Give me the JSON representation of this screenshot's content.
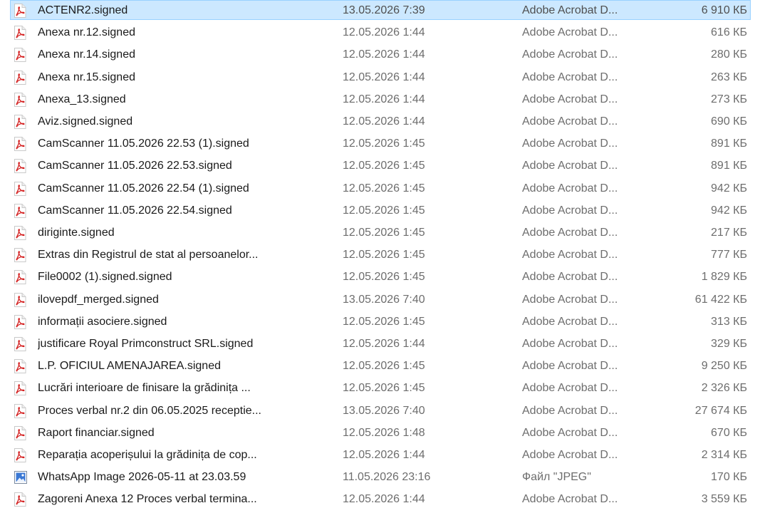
{
  "colors": {
    "selection_bg": "#cce8ff",
    "selection_border": "#99d1ff",
    "pdf_red": "#d42020",
    "secondary_text": "#6d6d6d"
  },
  "files": [
    {
      "name": "ACTENR2.signed",
      "date": "13.05.2026 7:39",
      "type": "Adobe Acrobat D...",
      "size": "6 910 КБ",
      "icon": "pdf-icon",
      "selected": true
    },
    {
      "name": "Anexa nr.12.signed",
      "date": "12.05.2026 1:44",
      "type": "Adobe Acrobat D...",
      "size": "616 КБ",
      "icon": "pdf-icon",
      "selected": false
    },
    {
      "name": "Anexa nr.14.signed",
      "date": "12.05.2026 1:44",
      "type": "Adobe Acrobat D...",
      "size": "280 КБ",
      "icon": "pdf-icon",
      "selected": false
    },
    {
      "name": "Anexa nr.15.signed",
      "date": "12.05.2026 1:44",
      "type": "Adobe Acrobat D...",
      "size": "263 КБ",
      "icon": "pdf-icon",
      "selected": false
    },
    {
      "name": "Anexa_13.signed",
      "date": "12.05.2026 1:44",
      "type": "Adobe Acrobat D...",
      "size": "273 КБ",
      "icon": "pdf-icon",
      "selected": false
    },
    {
      "name": "Aviz.signed.signed",
      "date": "12.05.2026 1:44",
      "type": "Adobe Acrobat D...",
      "size": "690 КБ",
      "icon": "pdf-icon",
      "selected": false
    },
    {
      "name": "CamScanner 11.05.2026 22.53 (1).signed",
      "date": "12.05.2026 1:45",
      "type": "Adobe Acrobat D...",
      "size": "891 КБ",
      "icon": "pdf-icon",
      "selected": false
    },
    {
      "name": "CamScanner 11.05.2026 22.53.signed",
      "date": "12.05.2026 1:45",
      "type": "Adobe Acrobat D...",
      "size": "891 КБ",
      "icon": "pdf-icon",
      "selected": false
    },
    {
      "name": "CamScanner 11.05.2026 22.54 (1).signed",
      "date": "12.05.2026 1:45",
      "type": "Adobe Acrobat D...",
      "size": "942 КБ",
      "icon": "pdf-icon",
      "selected": false
    },
    {
      "name": "CamScanner 11.05.2026 22.54.signed",
      "date": "12.05.2026 1:45",
      "type": "Adobe Acrobat D...",
      "size": "942 КБ",
      "icon": "pdf-icon",
      "selected": false
    },
    {
      "name": "diriginte.signed",
      "date": "12.05.2026 1:45",
      "type": "Adobe Acrobat D...",
      "size": "217 КБ",
      "icon": "pdf-icon",
      "selected": false
    },
    {
      "name": "Extras din Registrul de stat al persoanelor...",
      "date": "12.05.2026 1:45",
      "type": "Adobe Acrobat D...",
      "size": "777 КБ",
      "icon": "pdf-icon",
      "selected": false
    },
    {
      "name": "File0002 (1).signed.signed",
      "date": "12.05.2026 1:45",
      "type": "Adobe Acrobat D...",
      "size": "1 829 КБ",
      "icon": "pdf-icon",
      "selected": false
    },
    {
      "name": "ilovepdf_merged.signed",
      "date": "13.05.2026 7:40",
      "type": "Adobe Acrobat D...",
      "size": "61 422 КБ",
      "icon": "pdf-icon",
      "selected": false
    },
    {
      "name": "informații asociere.signed",
      "date": "12.05.2026 1:45",
      "type": "Adobe Acrobat D...",
      "size": "313 КБ",
      "icon": "pdf-icon",
      "selected": false
    },
    {
      "name": "justificare Royal Primconstruct SRL.signed",
      "date": "12.05.2026 1:44",
      "type": "Adobe Acrobat D...",
      "size": "329 КБ",
      "icon": "pdf-icon",
      "selected": false
    },
    {
      "name": "L.P. OFICIUL AMENAJAREA.signed",
      "date": "12.05.2026 1:45",
      "type": "Adobe Acrobat D...",
      "size": "9 250 КБ",
      "icon": "pdf-icon",
      "selected": false
    },
    {
      "name": "Lucrări interioare de finisare la grădinița ...",
      "date": "12.05.2026 1:45",
      "type": "Adobe Acrobat D...",
      "size": "2 326 КБ",
      "icon": "pdf-icon",
      "selected": false
    },
    {
      "name": "Proces verbal nr.2 din 06.05.2025 receptie...",
      "date": "13.05.2026 7:40",
      "type": "Adobe Acrobat D...",
      "size": "27 674 КБ",
      "icon": "pdf-icon",
      "selected": false
    },
    {
      "name": "Raport financiar.signed",
      "date": "12.05.2026 1:48",
      "type": "Adobe Acrobat D...",
      "size": "670 КБ",
      "icon": "pdf-icon",
      "selected": false
    },
    {
      "name": "Reparația acoperișului la grădinița de cop...",
      "date": "12.05.2026 1:44",
      "type": "Adobe Acrobat D...",
      "size": "2 314 КБ",
      "icon": "pdf-icon",
      "selected": false
    },
    {
      "name": "WhatsApp Image 2026-05-11 at 23.03.59",
      "date": "11.05.2026 23:16",
      "type": "Файл \"JPEG\"",
      "size": "170 КБ",
      "icon": "image-icon",
      "selected": false
    },
    {
      "name": "Zagoreni Anexa 12 Proces verbal termina...",
      "date": "12.05.2026 1:44",
      "type": "Adobe Acrobat D...",
      "size": "3 559 КБ",
      "icon": "pdf-icon",
      "selected": false
    }
  ]
}
